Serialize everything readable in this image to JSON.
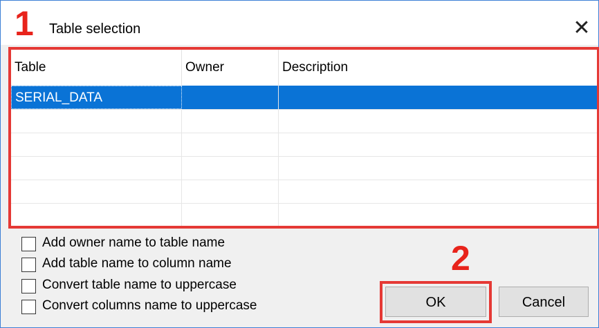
{
  "dialog": {
    "title": "Table selection",
    "close_glyph": "✕"
  },
  "annotations": {
    "marker_1": "1",
    "marker_2": "2",
    "highlight_color": "#e53935"
  },
  "table": {
    "columns": [
      "Table",
      "Owner",
      "Description"
    ],
    "rows": [
      [
        "SERIAL_DATA",
        "",
        ""
      ],
      [
        "",
        "",
        ""
      ],
      [
        "",
        "",
        ""
      ],
      [
        "",
        "",
        ""
      ],
      [
        "",
        "",
        ""
      ],
      [
        "",
        "",
        ""
      ]
    ],
    "selected_row": 0,
    "selection_color": "#0a73d6"
  },
  "options": [
    {
      "label": "Add owner name to table name",
      "checked": false
    },
    {
      "label": "Add table name to column name",
      "checked": false
    },
    {
      "label": "Convert table name to uppercase",
      "checked": false
    },
    {
      "label": "Convert columns name to uppercase",
      "checked": false
    }
  ],
  "buttons": {
    "ok_label": "OK",
    "cancel_label": "Cancel"
  }
}
